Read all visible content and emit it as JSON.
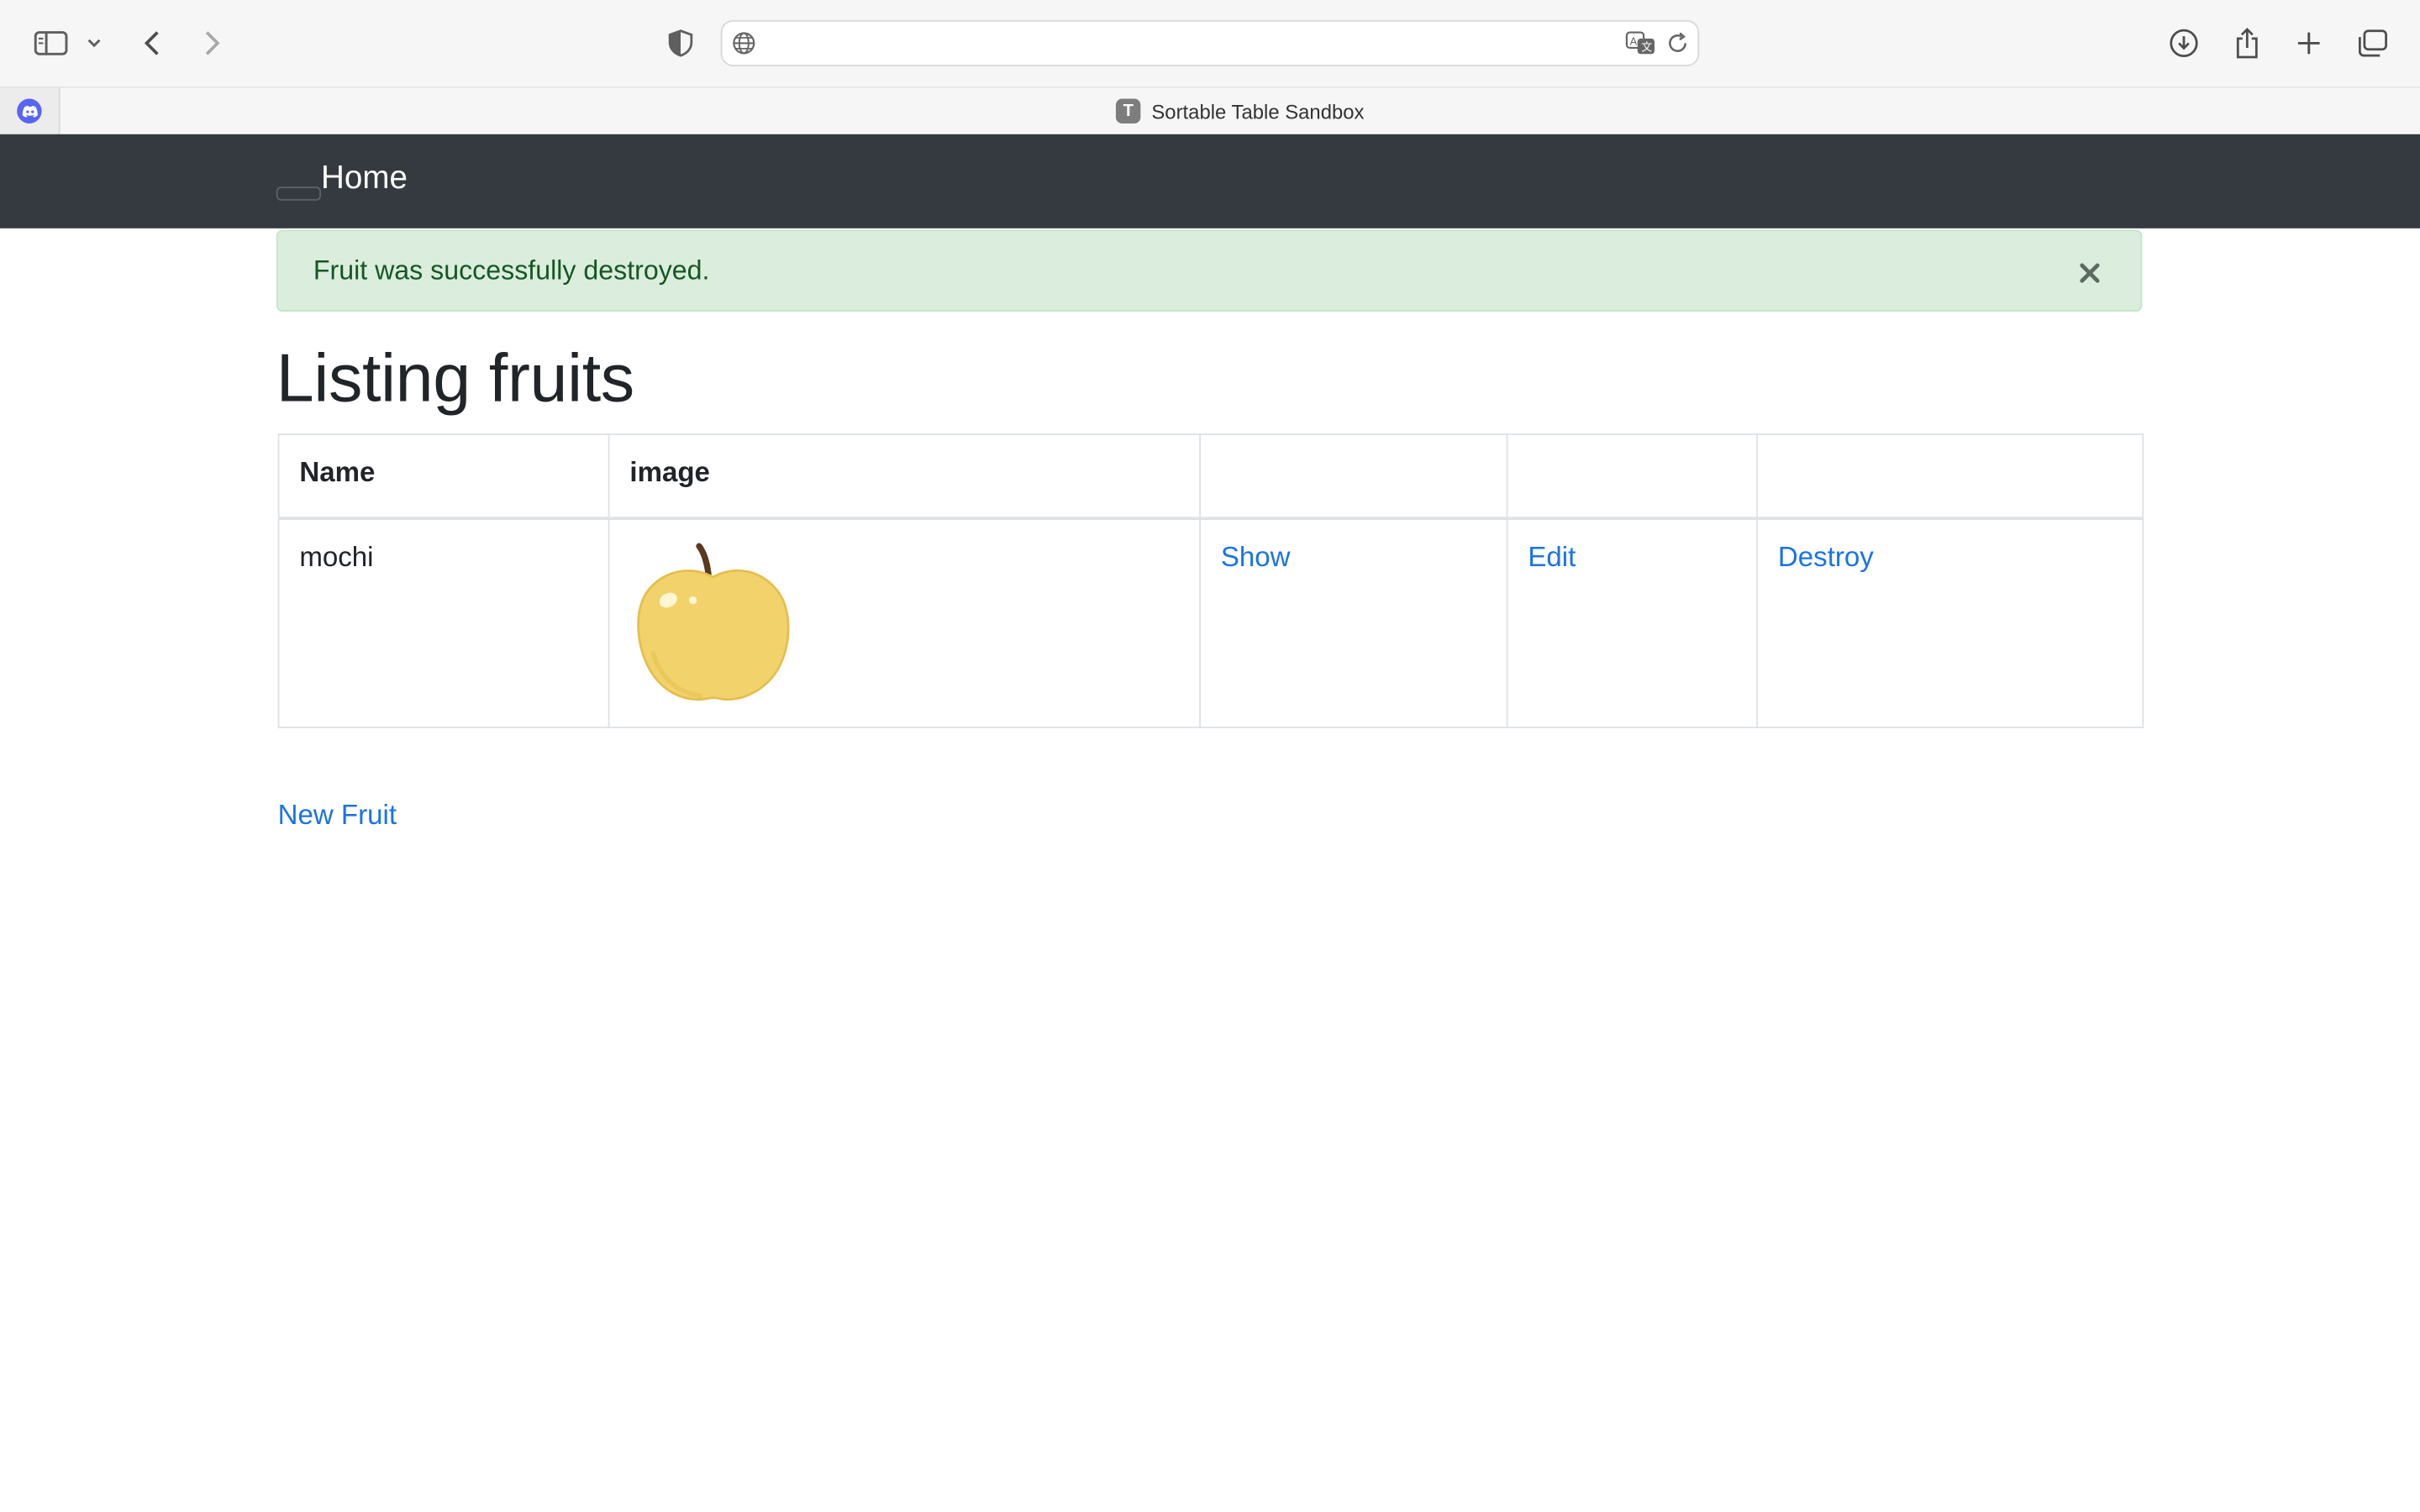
{
  "browser": {
    "tab": {
      "title": "Sortable Table Sandbox",
      "favicon_letter": "T"
    },
    "address_bar": {
      "url": ""
    },
    "pinned_tab_icon": "discord-icon"
  },
  "navbar": {
    "brand": "Home",
    "background": "#343a40"
  },
  "alert": {
    "message": "Fruit was successfully destroyed.",
    "close_symbol": "×",
    "background": "#dbeddc",
    "text_color": "#155724"
  },
  "page": {
    "title": "Listing fruits",
    "new_link": "New Fruit"
  },
  "table": {
    "headers": [
      "Name",
      "image",
      "",
      "",
      ""
    ],
    "rows": [
      {
        "name": "mochi",
        "image": "yellow-apple-image",
        "show": "Show",
        "edit": "Edit",
        "destroy": "Destroy"
      }
    ]
  },
  "colors": {
    "link": "#1a73e8"
  }
}
